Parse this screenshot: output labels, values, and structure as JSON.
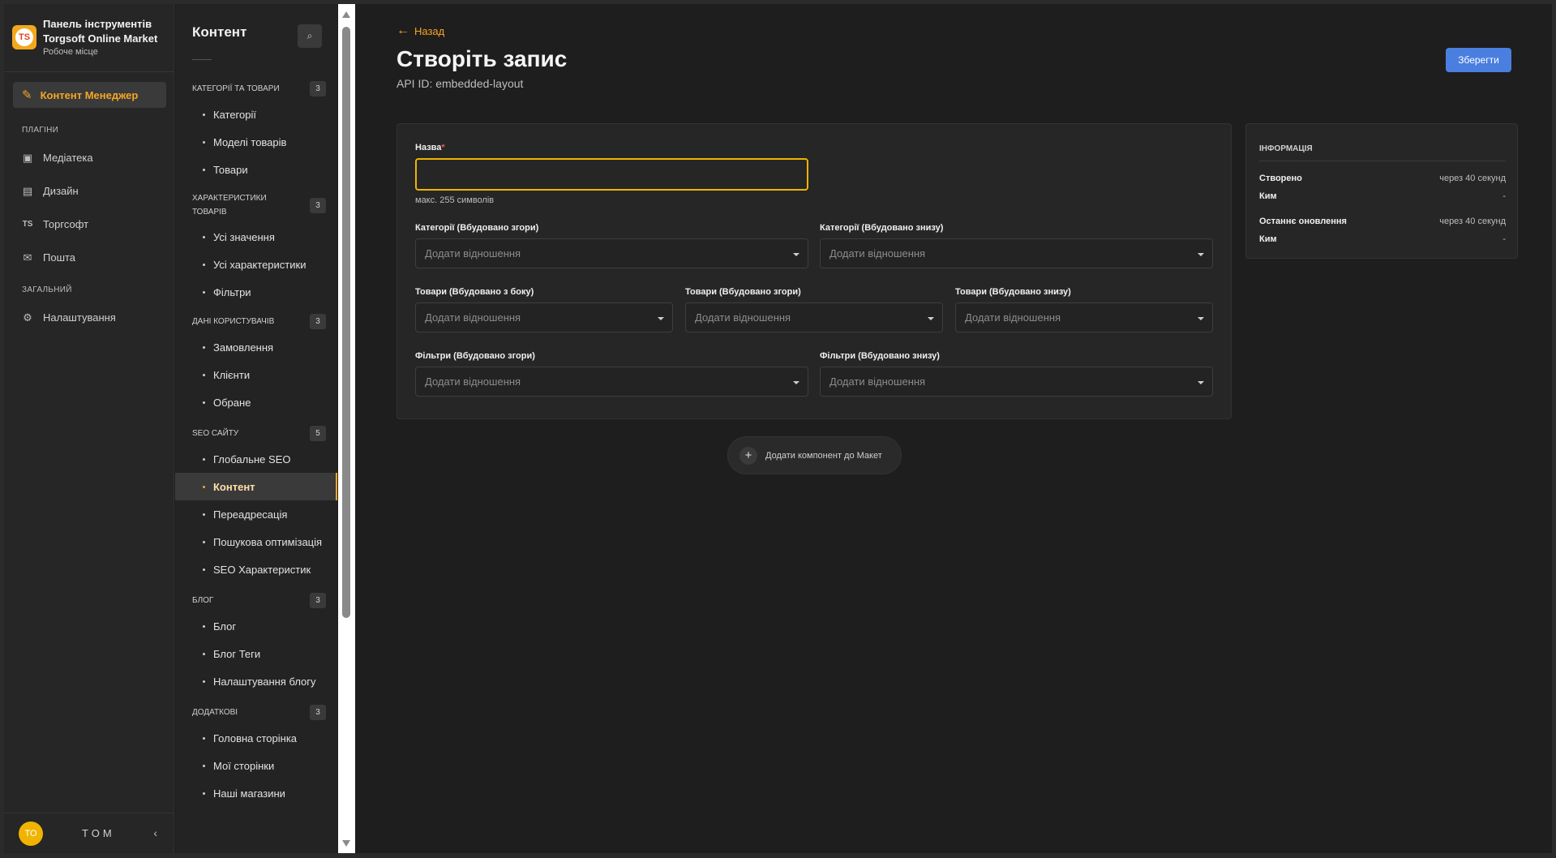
{
  "brand": {
    "logo": "TS",
    "title_line1": "Панель інструментів",
    "title_line2": "Torgsoft Online Market",
    "subtitle": "Робоче місце"
  },
  "nav": {
    "active": "Контент Менеджер",
    "plugins_section": "ПЛАГІНИ",
    "plugins": [
      {
        "label": "Медіатека",
        "icon": "image-icon"
      },
      {
        "label": "Дизайн",
        "icon": "paint-roller-icon"
      },
      {
        "label": "Торгсофт",
        "icon": "ts-icon"
      },
      {
        "label": "Пошта",
        "icon": "mail-icon"
      }
    ],
    "general_section": "ЗАГАЛЬНИЙ",
    "settings": "Налаштування"
  },
  "user": {
    "initials": "TO",
    "name": "TOM"
  },
  "content_sidebar": {
    "title": "Контент",
    "groups": [
      {
        "label": "КАТЕГОРІЇ ТА ТОВАРИ",
        "count": "3",
        "items": [
          "Категорії",
          "Моделі товарів",
          "Товари"
        ]
      },
      {
        "label": "ХАРАКТЕРИСТИКИ ТОВАРІВ",
        "count": "3",
        "items": [
          "Усі значення",
          "Усі характеристики",
          "Фільтри"
        ]
      },
      {
        "label": "ДАНІ КОРИСТУВАЧІВ",
        "count": "3",
        "items": [
          "Замовлення",
          "Клієнти",
          "Обране"
        ]
      },
      {
        "label": "SEO САЙТУ",
        "count": "5",
        "items": [
          "Глобальне SEO",
          "Контент",
          "Переадресація",
          "Пошукова оптимізація",
          "SEO Характеристик"
        ]
      },
      {
        "label": "БЛОГ",
        "count": "3",
        "items": [
          "Блог",
          "Блог Теги",
          "Налаштування блогу"
        ]
      },
      {
        "label": "ДОДАТКОВІ",
        "count": "3",
        "items": [
          "Головна сторінка",
          "Мої сторінки",
          "Наші магазини"
        ]
      }
    ]
  },
  "main": {
    "back": "Назад",
    "title": "Створіть запис",
    "api_id": "API ID: embedded-layout",
    "save": "Зберегти",
    "name_label": "Назва",
    "name_required": "*",
    "name_value": "",
    "name_hint": "макс. 255 символів",
    "relation_placeholder": "Додати відношення",
    "fields": {
      "cat_top": "Категорії (Вбудовано згори)",
      "cat_bottom": "Категорії (Вбудовано знизу)",
      "prod_side": "Товари (Вбудовано з боку)",
      "prod_top": "Товари (Вбудовано згори)",
      "prod_bottom": "Товари (Вбудовано знизу)",
      "filt_top": "Фільтри (Вбудовано згори)",
      "filt_bottom": "Фільтри (Вбудовано знизу)"
    },
    "add_component": "Додати компонент до Макет"
  },
  "info": {
    "title": "ІНФОРМАЦІЯ",
    "created_label": "Створено",
    "created_value": "через 40 секунд",
    "created_by_label": "Ким",
    "created_by_value": "-",
    "updated_label": "Останнє оновлення",
    "updated_value": "через 40 секунд",
    "updated_by_label": "Ким",
    "updated_by_value": "-"
  }
}
